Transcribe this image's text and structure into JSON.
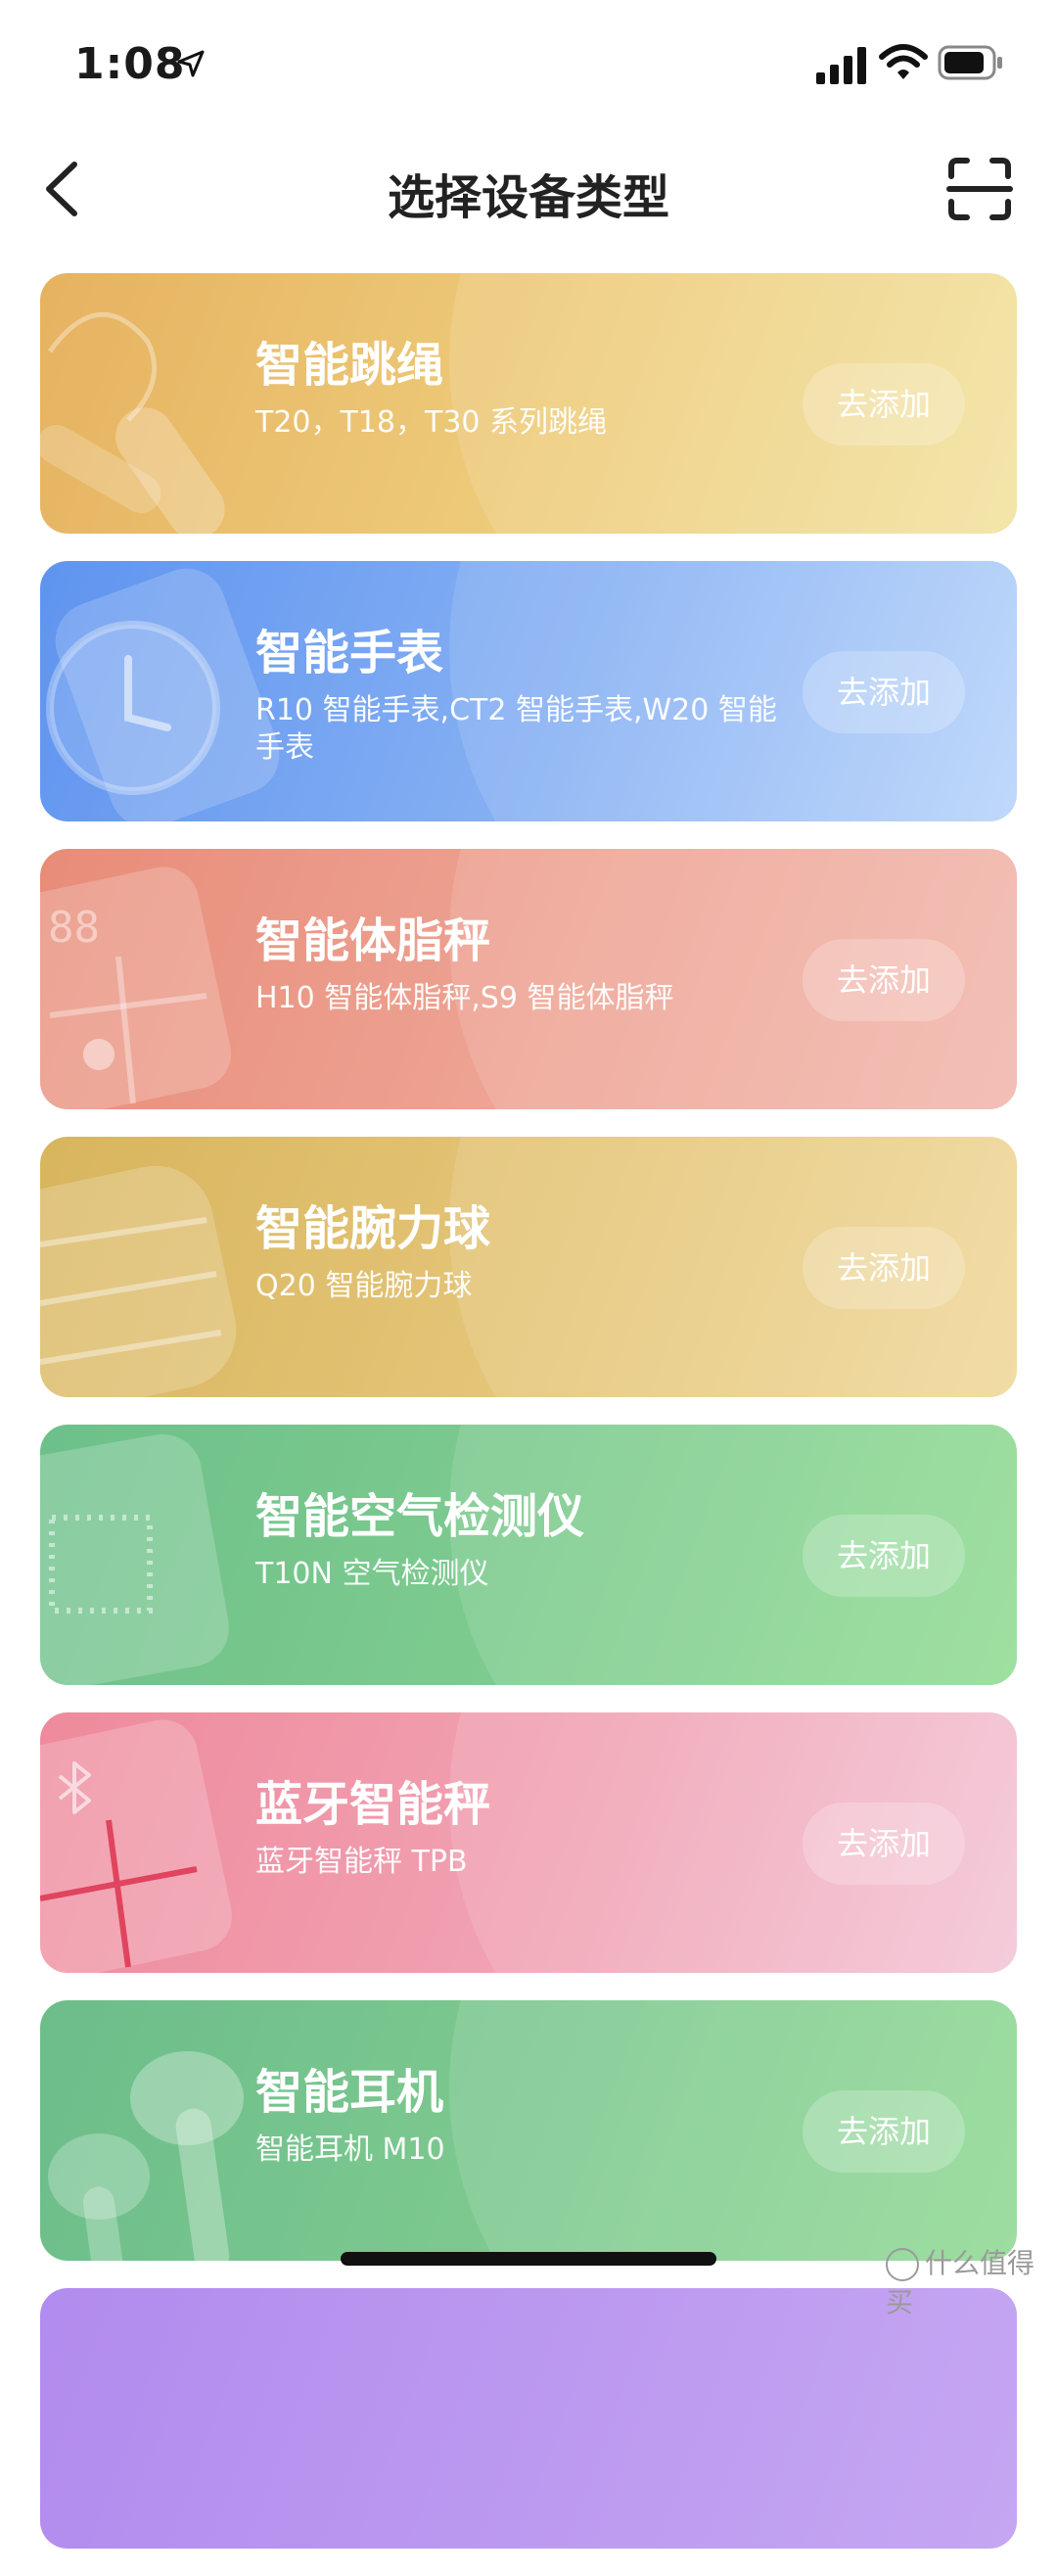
{
  "status_bar": {
    "time": "1:08"
  },
  "nav": {
    "title": "选择设备类型"
  },
  "cards": [
    {
      "title": "智能跳绳",
      "subtitle": "T20，T18，T30 系列跳绳",
      "button": "去添加"
    },
    {
      "title": "智能手表",
      "subtitle": "R10 智能手表,CT2 智能手表,W20 智能手表",
      "button": "去添加"
    },
    {
      "title": "智能体脂秤",
      "subtitle": "H10 智能体脂秤,S9 智能体脂秤",
      "button": "去添加"
    },
    {
      "title": "智能腕力球",
      "subtitle": "Q20 智能腕力球",
      "button": "去添加"
    },
    {
      "title": "智能空气检测仪",
      "subtitle": "T10N 空气检测仪",
      "button": "去添加"
    },
    {
      "title": "蓝牙智能秤",
      "subtitle": "蓝牙智能秤 TPB",
      "button": "去添加"
    },
    {
      "title": "智能耳机",
      "subtitle": "智能耳机 M10",
      "button": "去添加"
    }
  ],
  "watermark": "什么值得买",
  "colors": {
    "rope": "#e6b260",
    "watch": "#5f94ef",
    "fat": "#e88c78",
    "wrist": "#d8b55d",
    "air": "#6dc08a",
    "scale": "#ee8a9c",
    "earphone": "#6cbd8a"
  }
}
